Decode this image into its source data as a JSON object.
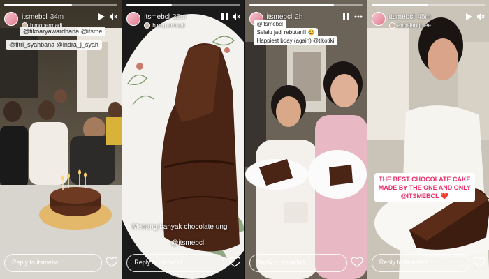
{
  "stories": [
    {
      "user": "itsmebcl",
      "time": "34m",
      "sub_user": "bimopermadi",
      "mentions": [
        "@tikoaryawardhana",
        "@itsme",
        "@fitri_syahbana",
        "@indra_j_syah"
      ],
      "reply_placeholder": "Reply to itsmebcl..."
    },
    {
      "user": "itsmebcl",
      "time": "35m",
      "sub_user": "bimopermadi",
      "caption": "Menang banyak chocolate ung",
      "caption_mention": "@itsmebcl",
      "reply_placeholder": "Reply to itsmebcl..."
    },
    {
      "user": "itsmebcl",
      "time": "2h",
      "sticker_line1": "Selalu jadi rebutan!! 😂",
      "sticker_line2": "Happiest bday (again) @tikotiki",
      "header_text": "@itsmebcl",
      "reply_placeholder": "Reply to itsmebcl..."
    },
    {
      "user": "itsmebcl",
      "time": "45m",
      "sub_user": "angelangqiee",
      "caption_line1": "THE BEST CHOCOLATE CAKE",
      "caption_line2": "MADE BY THE ONE AND ONLY",
      "caption_line3": "@ITSMEBCL ❤️",
      "reply_placeholder": "Reply to itsmebcl..."
    }
  ],
  "icons": {
    "play": "play-icon",
    "mute": "mute-icon",
    "more": "more-icon",
    "heart": "heart-icon"
  }
}
